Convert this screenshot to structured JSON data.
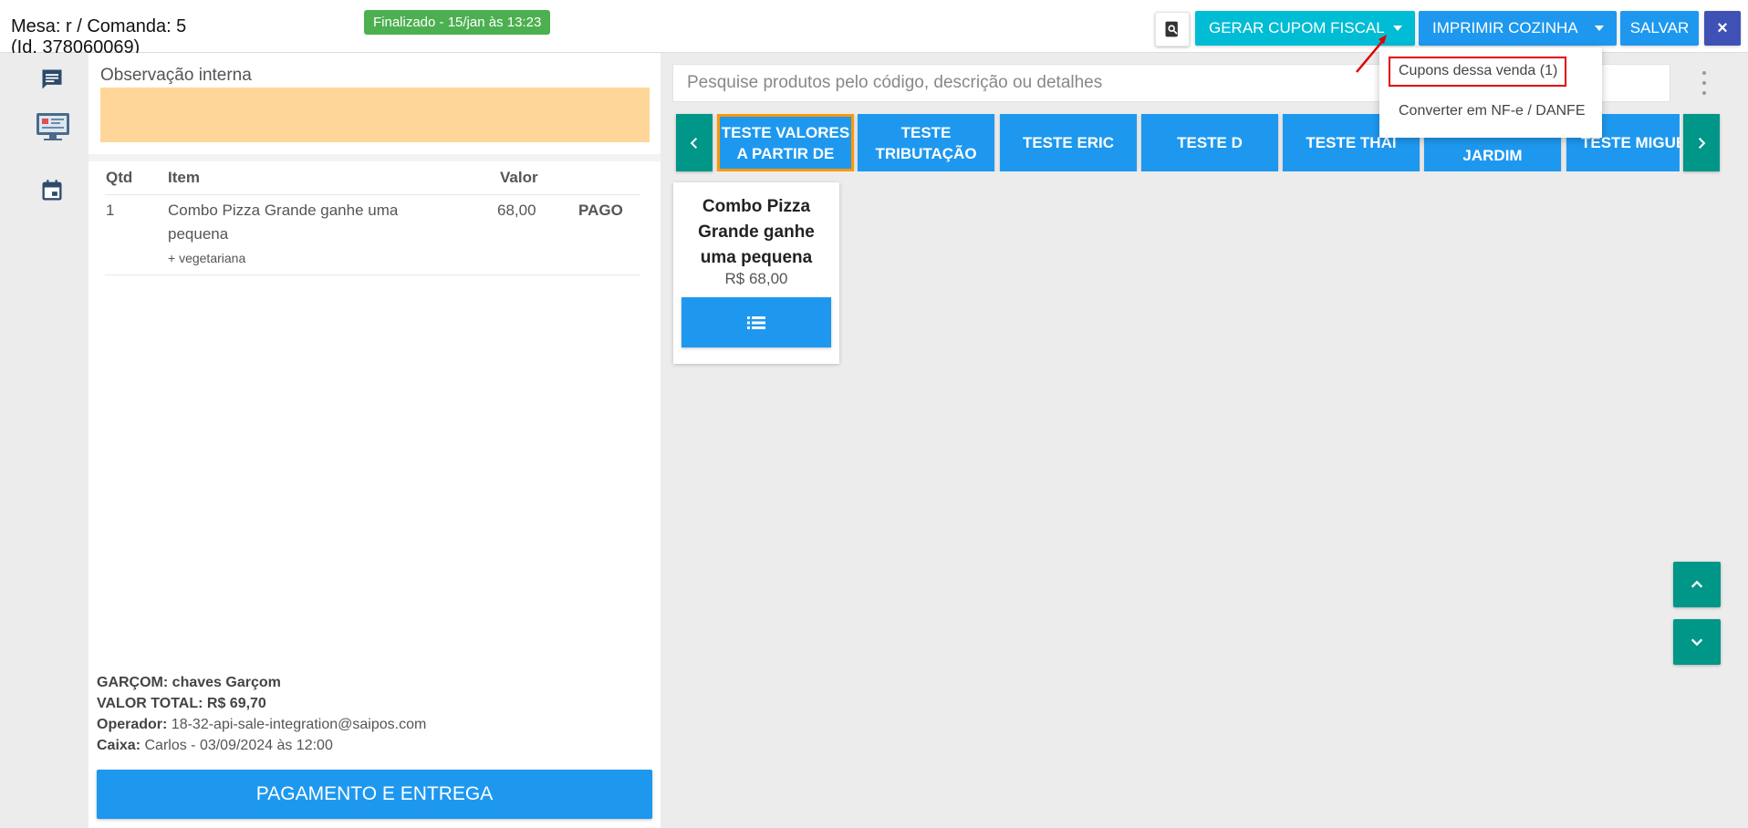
{
  "header": {
    "title_line1": "Mesa: r / Comanda: 5",
    "title_line2": "(Id. 378060069)",
    "status": "Finalizado - 15/jan às 13:23",
    "btn_cupom": "GERAR CUPOM FISCAL",
    "btn_cozinha": "IMPRIMIR COZINHA",
    "btn_salvar": "SALVAR",
    "btn_close": "×"
  },
  "dropdown": {
    "items": [
      "Cupons dessa venda (1)",
      "Converter em NF-e / DANFE"
    ]
  },
  "left": {
    "obs_label": "Observação interna",
    "columns": [
      "Qtd",
      "Item",
      "Valor"
    ],
    "rows": [
      {
        "qty": "1",
        "item": "Combo Pizza Grande ganhe uma pequena",
        "addon": "+ vegetariana",
        "value": "68,00",
        "status": "PAGO"
      }
    ],
    "info": {
      "garcom_label": "GARÇOM:",
      "garcom_value": "chaves Garçom",
      "total_label": "VALOR TOTAL:",
      "total_value": "R$ 69,70",
      "operador_label": "Operador:",
      "operador_value": "18-32-api-sale-integration@saipos.com",
      "caixa_label": "Caixa:",
      "caixa_value": "Carlos - 03/09/2024 às 12:00"
    },
    "pay_button": "PAGAMENTO E ENTREGA"
  },
  "search": {
    "placeholder": "Pesquise produtos pelo código, descrição ou detalhes"
  },
  "categories": [
    {
      "line1": "TESTE VALORES",
      "line2": "A PARTIR DE"
    },
    {
      "line1": "TESTE",
      "line2": "TRIBUTAÇÃO"
    },
    {
      "line1": "TESTE ERIC",
      "line2": ""
    },
    {
      "line1": "TESTE D",
      "line2": ""
    },
    {
      "line1": "TESTE THAI",
      "line2": ""
    },
    {
      "line1": "",
      "line2": "JARDIM"
    },
    {
      "line1": "TESTE MIGUE",
      "line2": ""
    }
  ],
  "product": {
    "name": "Combo Pizza Grande ganhe uma pequena",
    "price": "R$ 68,00"
  },
  "icons": {
    "search": "search-zoom-icon",
    "chat": "chat-icon",
    "monitor": "monitor-icon",
    "calendar": "calendar-icon",
    "list": "list-icon"
  },
  "colors": {
    "primary": "#1e98ef",
    "cyan": "#00bcd4",
    "teal": "#009688",
    "indigo": "#3f51b5",
    "status_green": "#4caf50",
    "obs_bg": "#ffd699",
    "highlight": "#e00000",
    "active_border": "#ff9800"
  }
}
